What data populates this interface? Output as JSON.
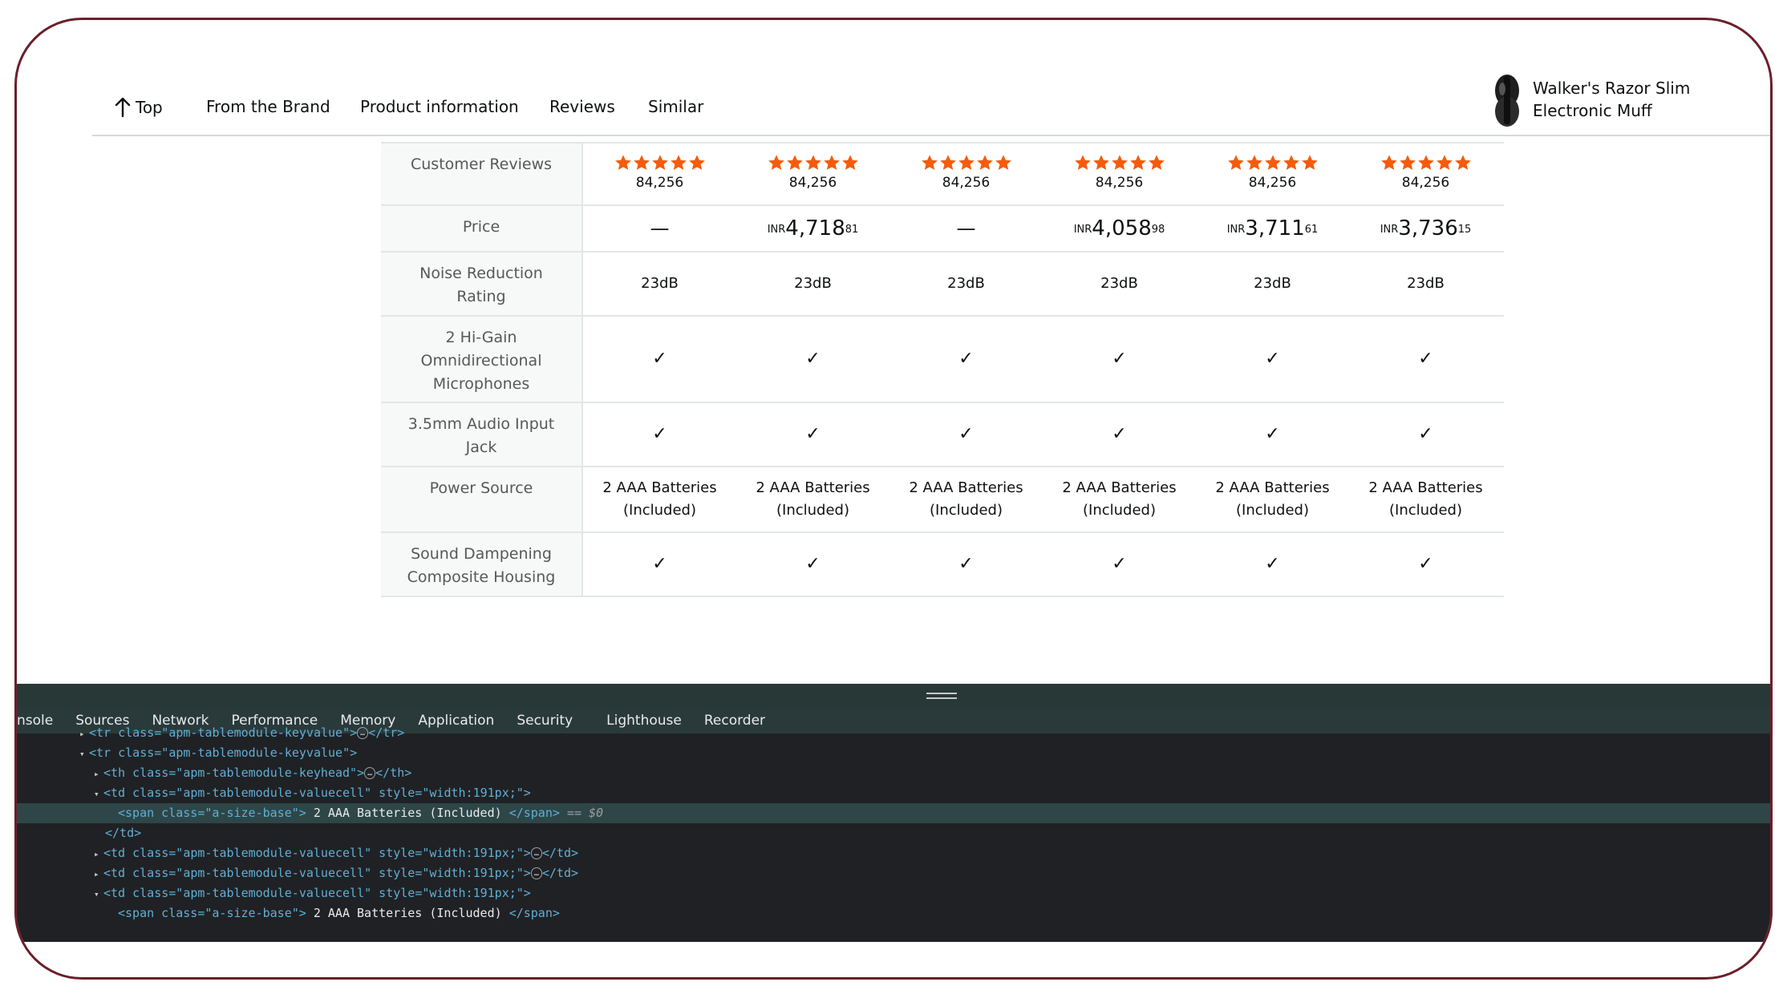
{
  "nav": {
    "top_label": "Top",
    "links": [
      "From the Brand",
      "Product information",
      "Reviews",
      "Similar"
    ],
    "product_title": "Walker's Razor Slim Electronic Muff"
  },
  "comparison": {
    "reviews_label": "Customer Reviews",
    "rating_stars": 5,
    "review_counts": [
      "84,256",
      "84,256",
      "84,256",
      "84,256",
      "84,256",
      "84,256"
    ],
    "price_label": "Price",
    "prices": [
      {
        "missing": "—"
      },
      {
        "currency": "INR",
        "whole": "4,718",
        "fraction": "81"
      },
      {
        "missing": "—"
      },
      {
        "currency": "INR",
        "whole": "4,058",
        "fraction": "98"
      },
      {
        "currency": "INR",
        "whole": "3,711",
        "fraction": "61"
      },
      {
        "currency": "INR",
        "whole": "3,736",
        "fraction": "15"
      }
    ],
    "noise_label": "Noise Reduction Rating",
    "noise_values": [
      "23dB",
      "23dB",
      "23dB",
      "23dB",
      "23dB",
      "23dB"
    ],
    "mic_label": "2 Hi-Gain Omnidirectional Microphones",
    "mic_values": [
      "✓",
      "✓",
      "✓",
      "✓",
      "✓",
      "✓"
    ],
    "jack_label": "3.5mm Audio Input Jack",
    "jack_values": [
      "✓",
      "✓",
      "✓",
      "✓",
      "✓",
      "✓"
    ],
    "power_label": "Power Source",
    "power_values": [
      "2 AAA Batteries (Included)",
      "2 AAA Batteries (Included)",
      "2 AAA Batteries (Included)",
      "2 AAA Batteries (Included)",
      "2 AAA Batteries (Included)",
      "2 AAA Batteries (Included)"
    ],
    "housing_label": "Sound Dampening Composite Housing",
    "housing_values": [
      "✓",
      "✓",
      "✓",
      "✓",
      "✓",
      "✓"
    ]
  },
  "devtools": {
    "tabs": [
      "nsole",
      "Sources",
      "Network",
      "Performance",
      "Memory",
      "Application",
      "Security",
      "Lighthouse",
      "Recorder"
    ],
    "code": {
      "row_open_collapsed": "<tr class=\"apm-tablemodule-keyvalue\">",
      "row_close": "</tr>",
      "row_open": "<tr class=\"apm-tablemodule-keyvalue\">",
      "th_open": "<th class=\"apm-tablemodule-keyhead\">",
      "th_close": "</th>",
      "td_open": "<td class=\"apm-tablemodule-valuecell\" style=\"width:191px;\">",
      "td_close": "</td>",
      "span_open": "<span class=\"a-size-base\">",
      "span_text": " 2 AAA Batteries (Included) ",
      "span_close": "</span>",
      "selected_suffix": " == $0",
      "ellipsis": "…"
    }
  },
  "colors": {
    "star": "#f55b0a",
    "frame": "#6b1f2a",
    "devtools_bg": "#202124",
    "devtools_tabbar": "#2a3a3b",
    "selected_line": "#2e4648"
  }
}
